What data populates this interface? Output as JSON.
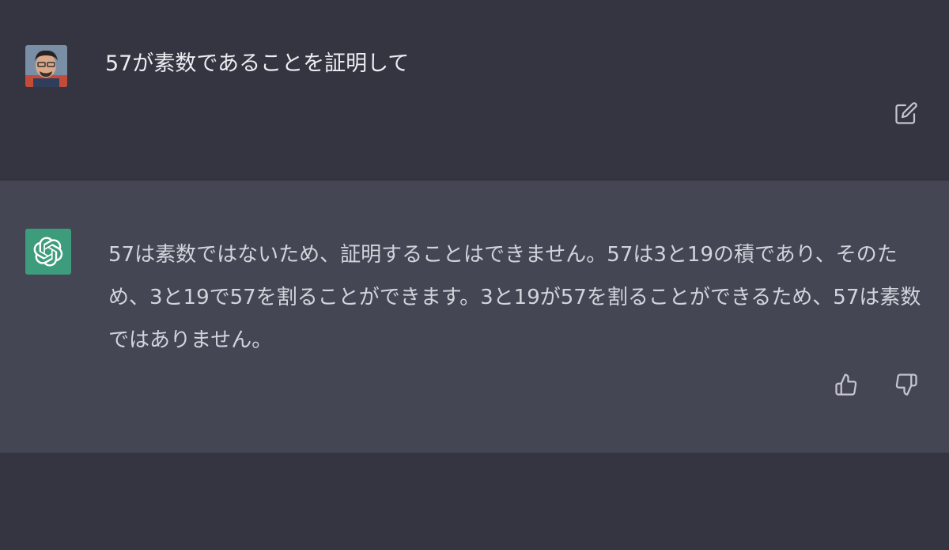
{
  "conversation": {
    "user_message": {
      "text": "57が素数であることを証明して",
      "edit_icon": "edit-icon",
      "avatar_icon": "user-avatar"
    },
    "assistant_message": {
      "text": "57は素数ではないため、証明することはできません。57は3と19の積であり、そのため、3と19で57を割ることができます。3と19が57を割ることができるため、57は素数ではありません。",
      "logo_icon": "openai-logo-icon",
      "feedback": {
        "thumbs_up_icon": "thumbs-up-icon",
        "thumbs_down_icon": "thumbs-down-icon"
      }
    }
  },
  "colors": {
    "background": "#343541",
    "assistant_background": "#444654",
    "text_primary": "#ececf1",
    "text_secondary": "#d1d5db",
    "icon": "#c5c5d2",
    "brand_green": "#3d9c7c"
  }
}
